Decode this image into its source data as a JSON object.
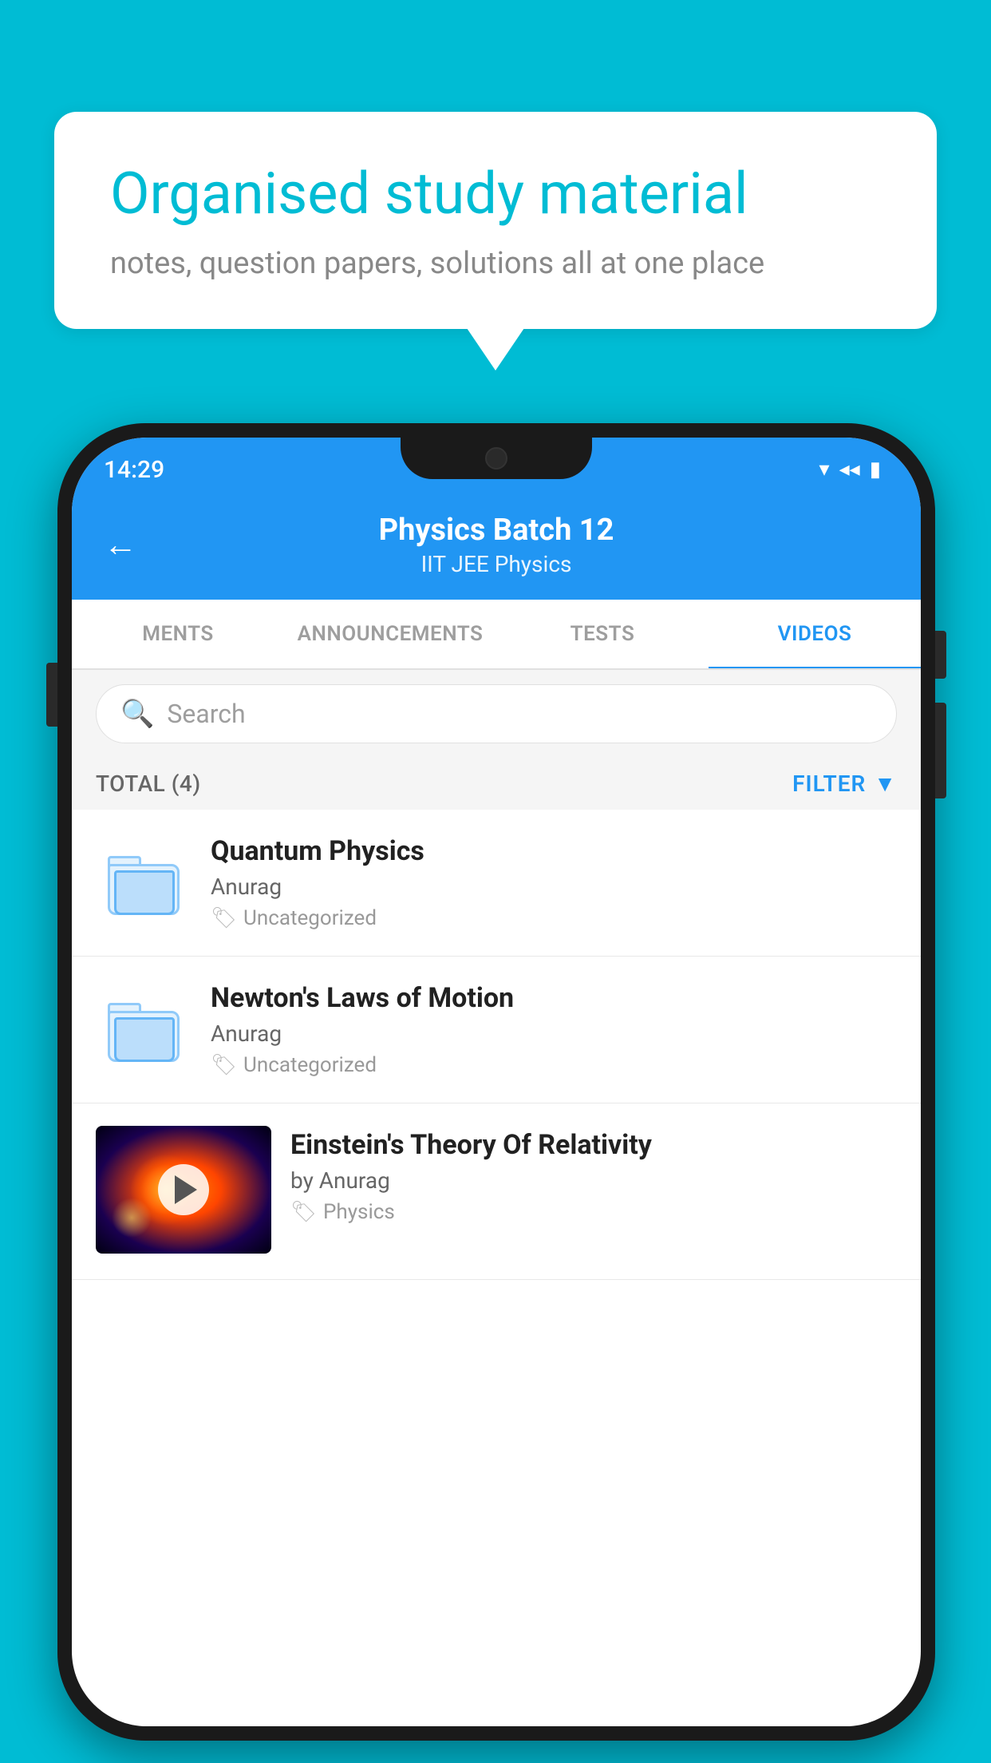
{
  "background_color": "#00bcd4",
  "speech_bubble": {
    "title": "Organised study material",
    "subtitle": "notes, question papers, solutions all at one place"
  },
  "phone": {
    "status_bar": {
      "time": "14:29",
      "wifi": "▾",
      "signal": "▴",
      "battery": "▮"
    },
    "header": {
      "back_label": "←",
      "title": "Physics Batch 12",
      "subtitle": "IIT JEE   Physics"
    },
    "tabs": [
      {
        "label": "MENTS",
        "active": false
      },
      {
        "label": "ANNOUNCEMENTS",
        "active": false
      },
      {
        "label": "TESTS",
        "active": false
      },
      {
        "label": "VIDEOS",
        "active": true
      }
    ],
    "search": {
      "placeholder": "Search"
    },
    "filter_row": {
      "total_label": "TOTAL (4)",
      "filter_label": "FILTER"
    },
    "videos": [
      {
        "title": "Quantum Physics",
        "author": "Anurag",
        "category": "Uncategorized",
        "type": "folder"
      },
      {
        "title": "Newton's Laws of Motion",
        "author": "Anurag",
        "category": "Uncategorized",
        "type": "folder"
      },
      {
        "title": "Einstein's Theory Of Relativity",
        "by_label": "by Anurag",
        "category": "Physics",
        "type": "thumbnail"
      }
    ]
  }
}
